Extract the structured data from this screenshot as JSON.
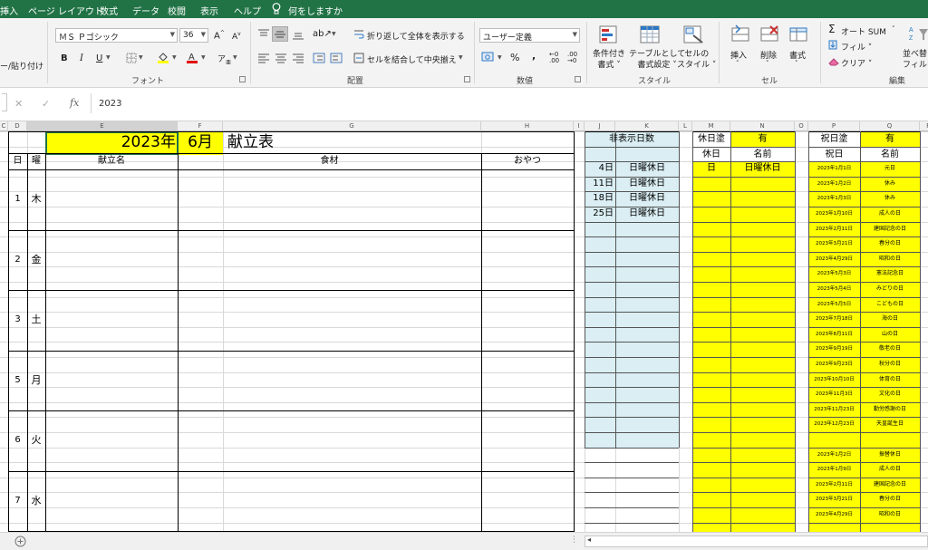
{
  "tabs": [
    "挿入",
    "ページ レイアウト",
    "数式",
    "データ",
    "校閲",
    "表示",
    "ヘルプ",
    "何をしますか"
  ],
  "ribbon": {
    "paste_label": "ー/貼り付け",
    "font_name": "ＭＳ Ｐゴシック",
    "font_size": "36",
    "font_group": "フォント",
    "wrap_text": "折り返して全体を表示する",
    "merge_center": "セルを結合して中央揃え",
    "align_group": "配置",
    "number_format": "ユーザー定義",
    "number_group": "数値",
    "cond_format": [
      "条件付き",
      "書式"
    ],
    "table_format": [
      "テーブルとして",
      "書式設定"
    ],
    "cell_style": [
      "セルの",
      "スタイル"
    ],
    "style_group": "スタイル",
    "insert": "挿入",
    "delete": "削除",
    "format": "書式",
    "cells_group": "セル",
    "autosum": "オート SUM",
    "fill": "フィル",
    "clear": "クリア",
    "sort_filter": [
      "並べ替",
      "フィルタ"
    ],
    "edit_group": "編集"
  },
  "formula_value": "2023",
  "columns": [
    "C",
    "D",
    "E",
    "F",
    "G",
    "H",
    "I",
    "J",
    "K",
    "L",
    "M",
    "N",
    "O",
    "P",
    "Q",
    "R"
  ],
  "sheet": {
    "year": "2023年",
    "month": "6月",
    "title": "献立表",
    "headers": {
      "day": "日",
      "weekday": "曜",
      "menu": "献立名",
      "ingredients": "食材",
      "snack": "おやつ"
    },
    "days": [
      {
        "day": "1",
        "wd": "木"
      },
      {
        "day": "2",
        "wd": "金"
      },
      {
        "day": "3",
        "wd": "土"
      },
      {
        "day": "5",
        "wd": "月"
      },
      {
        "day": "6",
        "wd": "火"
      },
      {
        "day": "7",
        "wd": "水"
      }
    ]
  },
  "hidden": {
    "title": "非表示日数",
    "rows": [
      {
        "d": "4日",
        "n": "日曜休日"
      },
      {
        "d": "11日",
        "n": "日曜休日"
      },
      {
        "d": "18日",
        "n": "日曜休日"
      },
      {
        "d": "25日",
        "n": "日曜休日"
      }
    ]
  },
  "holiday_paint": {
    "label": "休日塗",
    "value": "有",
    "col1": "休日",
    "col2": "名前",
    "row1": {
      "a": "日",
      "b": "日曜休日"
    }
  },
  "national": {
    "label": "祝日塗",
    "value": "有",
    "col1": "祝日",
    "col2": "名前",
    "rows": [
      {
        "date": "2023年1月1日",
        "name": "元日"
      },
      {
        "date": "2023年1月2日",
        "name": "休み"
      },
      {
        "date": "2023年1月3日",
        "name": "休み"
      },
      {
        "date": "2023年1月10日",
        "name": "成人の日"
      },
      {
        "date": "2023年2月11日",
        "name": "建国記念の日"
      },
      {
        "date": "2023年3月21日",
        "name": "春分の日"
      },
      {
        "date": "2023年4月29日",
        "name": "昭和の日"
      },
      {
        "date": "2023年5月3日",
        "name": "憲法記念日"
      },
      {
        "date": "2023年5月4日",
        "name": "みどりの日"
      },
      {
        "date": "2023年5月5日",
        "name": "こどもの日"
      },
      {
        "date": "2023年7月18日",
        "name": "海の日"
      },
      {
        "date": "2023年8月11日",
        "name": "山の日"
      },
      {
        "date": "2023年9月19日",
        "name": "敬老の日"
      },
      {
        "date": "2023年9月23日",
        "name": "秋分の日"
      },
      {
        "date": "2023年10月10日",
        "name": "体育の日"
      },
      {
        "date": "2023年11月3日",
        "name": "文化の日"
      },
      {
        "date": "2023年11月23日",
        "name": "勤労感謝の日"
      },
      {
        "date": "2023年12月23日",
        "name": "天皇誕生日"
      },
      {
        "date": "",
        "name": ""
      },
      {
        "date": "2023年1月2日",
        "name": "振替休日"
      },
      {
        "date": "2023年1月9日",
        "name": "成人の日"
      },
      {
        "date": "2023年2月11日",
        "name": "建国記念の日"
      },
      {
        "date": "2023年3月21日",
        "name": "春分の日"
      },
      {
        "date": "2023年4月29日",
        "name": "昭和の日"
      }
    ]
  },
  "colors": {
    "accent": "#217346",
    "yellow": "#ffff00",
    "lightblue": "#daeef3"
  }
}
